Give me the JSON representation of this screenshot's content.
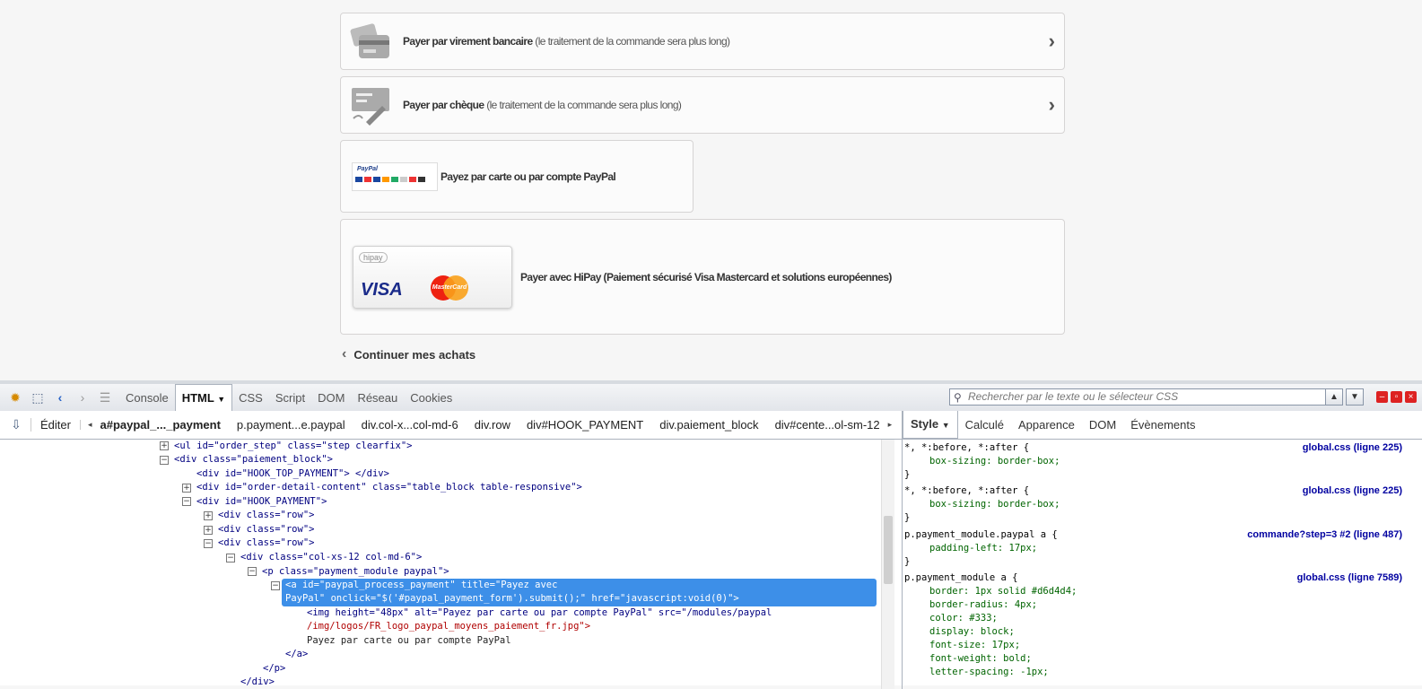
{
  "payments": [
    {
      "label": "Payer par virement bancaire",
      "note": "(le traitement de la commande sera plus long)",
      "icon": "bank-card-icon"
    },
    {
      "label": "Payer par chèque",
      "note": "(le traitement de la commande sera plus long)",
      "icon": "cheque-icon"
    },
    {
      "label": "Payez par carte ou par compte PayPal",
      "icon": "paypal-logo"
    },
    {
      "label": "Payer avec HiPay (Paiement sécurisé Visa Mastercard et solutions européennes)",
      "logo_text": "hipay",
      "visa": "VISA",
      "mastercard": "MasterCard"
    }
  ],
  "paypal_logo_text": "PayPal",
  "continue_label": "Continuer mes achats",
  "firebug": {
    "tabs": [
      "Console",
      "HTML",
      "CSS",
      "Script",
      "DOM",
      "Réseau",
      "Cookies"
    ],
    "active_tab": "HTML",
    "search_placeholder": "Rechercher par le texte ou le sélecteur CSS",
    "edit_label": "Éditer",
    "breadcrumbs": [
      "a#paypal_..._payment",
      "p.payment...e.paypal",
      "div.col-x...col-md-6",
      "div.row",
      "div#HOOK_PAYMENT",
      "div.paiement_block",
      "div#cente...ol-sm-12"
    ],
    "side_tabs": [
      "Style",
      "Calculé",
      "Apparence",
      "DOM",
      "Évènements"
    ],
    "html_lines": [
      {
        "t": "<ul id=\"order_step\" class=\"step clearfix\">"
      },
      {
        "t": "<div class=\"paiement_block\">"
      },
      {
        "t": "<div id=\"HOOK_TOP_PAYMENT\"> </div>"
      },
      {
        "t": "<div id=\"order-detail-content\" class=\"table_block table-responsive\">"
      },
      {
        "t": "<div id=\"HOOK_PAYMENT\">"
      },
      {
        "t": "<div class=\"row\">"
      },
      {
        "t": "<div class=\"row\">"
      },
      {
        "t": "<div class=\"row\">"
      },
      {
        "t": "<div class=\"col-xs-12 col-md-6\">"
      },
      {
        "t": "<p class=\"payment_module paypal\">"
      },
      {
        "t": "<a id=\"paypal_process_payment\" title=\"Payez avec"
      },
      {
        "t": "PayPal\" onclick=\"$('#paypal_payment_form').submit();\" href=\"javascript:void(0)\">"
      },
      {
        "t": "<img height=\"48px\" alt=\"Payez par carte ou par compte PayPal\" src=\"/modules/paypal"
      },
      {
        "t": "/img/logos/FR_logo_paypal_moyens_paiement_fr.jpg\">"
      },
      {
        "t": "Payez par carte ou par compte PayPal"
      },
      {
        "t": "</a>"
      },
      {
        "t": "</p>"
      },
      {
        "t": "</div>"
      }
    ],
    "css_rules": [
      {
        "selector": "*, *:before, *:after {",
        "source": "global.css (ligne 225)",
        "props": [
          "box-sizing: border-box;"
        ]
      },
      {
        "selector": "*, *:before, *:after {",
        "source": "global.css (ligne 225)",
        "props": [
          "box-sizing: border-box;"
        ]
      },
      {
        "selector": "p.payment_module.paypal a {",
        "source": "commande?step=3 #2 (ligne 487)",
        "props": [
          "padding-left: 17px;"
        ]
      },
      {
        "selector": "p.payment_module a {",
        "source": "global.css (ligne 7589)",
        "props": [
          "border: 1px solid #d6d4d4;",
          "border-radius: 4px;",
          "color: #333;",
          "display: block;",
          "font-size: 17px;",
          "font-weight: bold;",
          "letter-spacing: -1px;"
        ]
      }
    ]
  }
}
